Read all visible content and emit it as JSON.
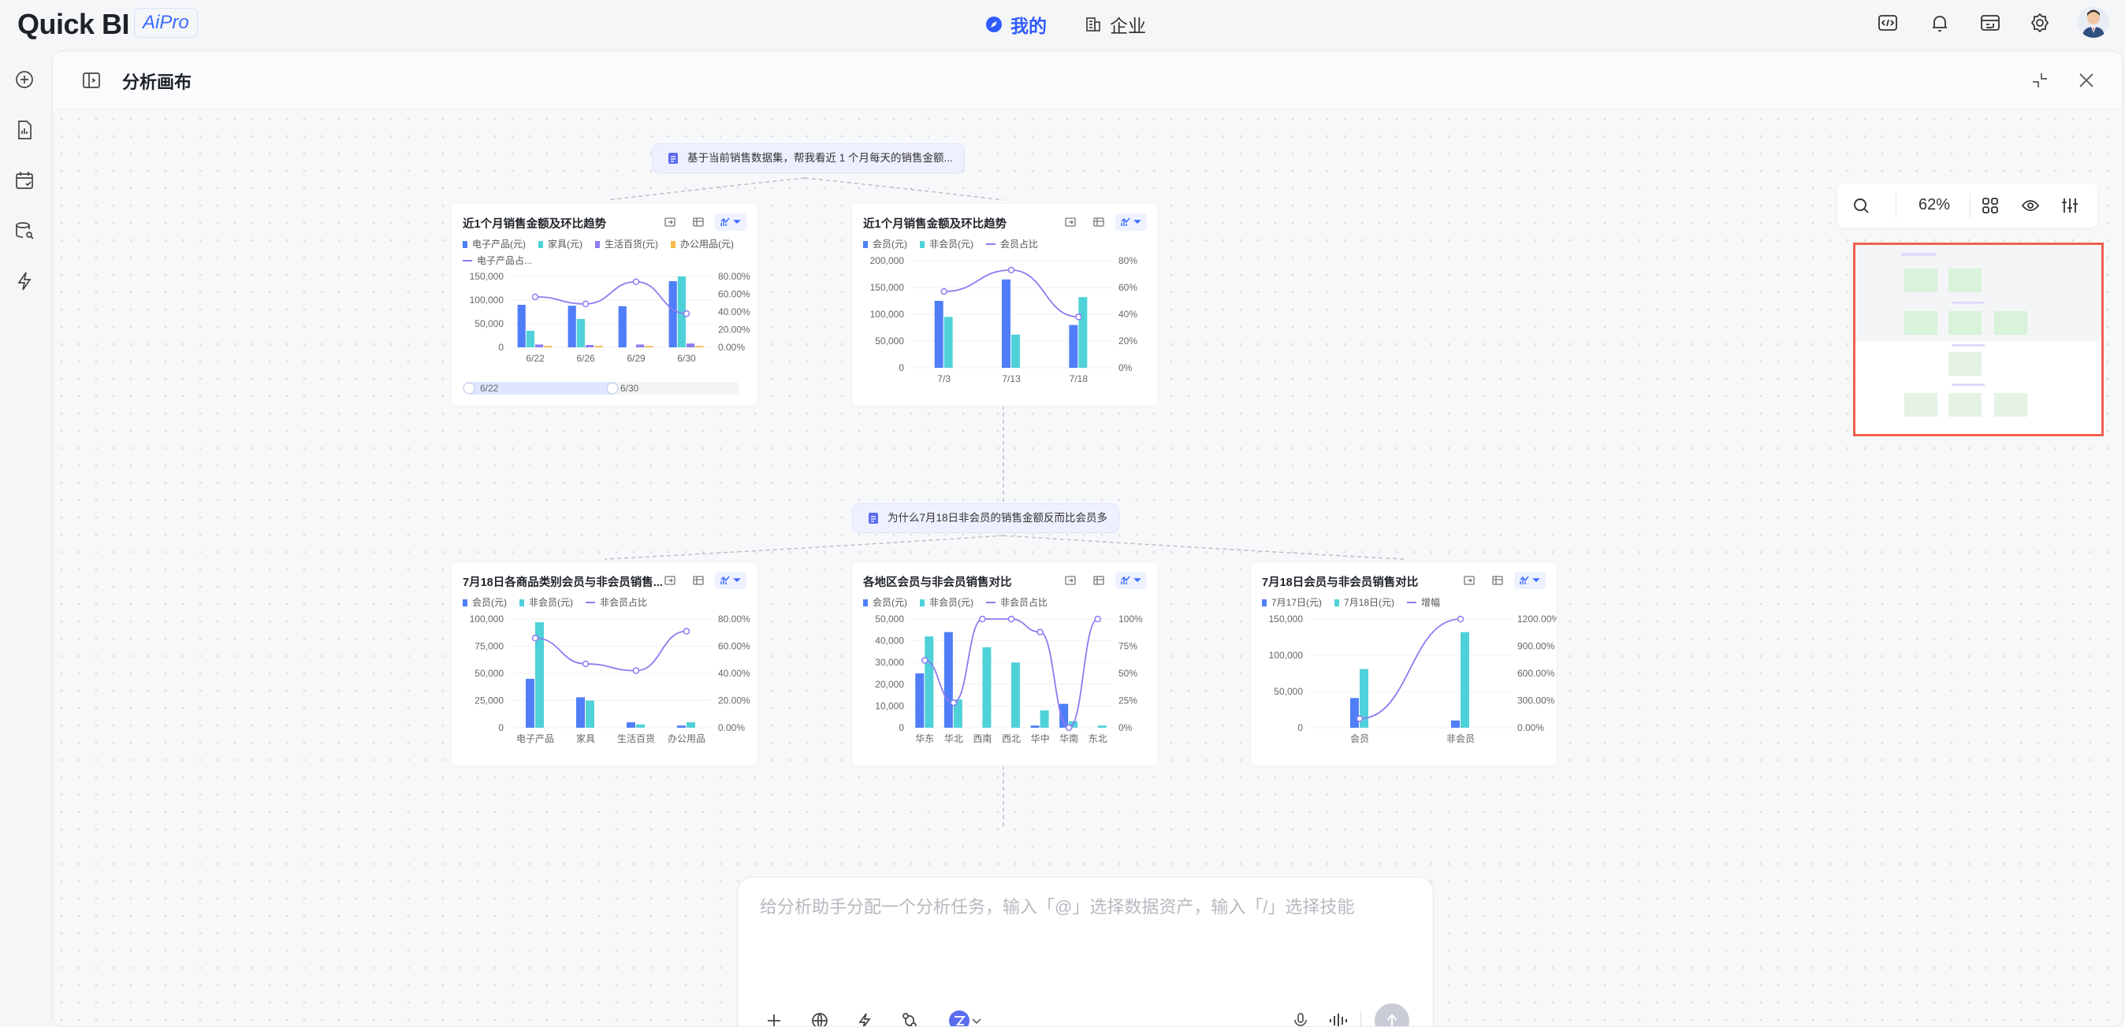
{
  "app": {
    "logo": "Quick BI",
    "badge": "AiPro"
  },
  "nav": {
    "mine": "我的",
    "enterprise": "企业"
  },
  "panel": {
    "title": "分析画布"
  },
  "toolbar": {
    "zoom": "62%"
  },
  "questions": {
    "q1": "基于当前销售数据集，帮我看近 1 个月每天的销售金额...",
    "q2": "为什么7月18日非会员的销售金额反而比会员多"
  },
  "input": {
    "placeholder": "给分析助手分配一个分析任务，输入「@」选择数据资产，输入「/」选择技能"
  },
  "colors": {
    "blue": "#4f7ef8",
    "cyan": "#4fd1d9",
    "purple": "#8b7cf0",
    "orange": "#f7b84b",
    "brand": "#2f5bff",
    "minimap_border": "#f06050"
  },
  "cards": [
    {
      "title": "近1个月销售金额及环比趋势",
      "legend": [
        "电子产品(元)",
        "家具(元)",
        "生活百货(元)",
        "办公用品(元)",
        "电子产品占..."
      ],
      "y_left": [
        "150,000",
        "100,000",
        "50,000",
        "0"
      ],
      "y_right": [
        "80.00%",
        "60.00%",
        "40.00%",
        "20.00%",
        "0.00%"
      ],
      "x": [
        "6/22",
        "6/26",
        "6/29",
        "6/30"
      ],
      "slider": {
        "start": "6/22",
        "end": "6/30"
      }
    },
    {
      "title": "近1个月销售金额及环比趋势",
      "legend": [
        "会员(元)",
        "非会员(元)",
        "会员占比"
      ],
      "y_left": [
        "200,000",
        "150,000",
        "100,000",
        "50,000",
        "0"
      ],
      "y_right": [
        "80%",
        "60%",
        "40%",
        "20%",
        "0%"
      ],
      "x": [
        "7/3",
        "7/13",
        "7/18"
      ]
    },
    {
      "title": "7月18日各商品类别会员与非会员销售...",
      "legend": [
        "会员(元)",
        "非会员(元)",
        "非会员占比"
      ],
      "y_left": [
        "100,000",
        "75,000",
        "50,000",
        "25,000",
        "0"
      ],
      "y_right": [
        "80.00%",
        "60.00%",
        "40.00%",
        "20.00%",
        "0.00%"
      ],
      "x": [
        "电子产品",
        "家具",
        "生活百货",
        "办公用品"
      ]
    },
    {
      "title": "各地区会员与非会员销售对比",
      "legend": [
        "会员(元)",
        "非会员(元)",
        "非会员占比"
      ],
      "y_left": [
        "50,000",
        "40,000",
        "30,000",
        "20,000",
        "10,000",
        "0"
      ],
      "y_right": [
        "100%",
        "75%",
        "50%",
        "25%",
        "0%"
      ],
      "x": [
        "华东",
        "华北",
        "西南",
        "西北",
        "华中",
        "华南",
        "东北"
      ]
    },
    {
      "title": "7月18日会员与非会员销售对比",
      "legend": [
        "7月17日(元)",
        "7月18日(元)",
        "增幅"
      ],
      "y_left": [
        "150,000",
        "100,000",
        "50,000",
        "0"
      ],
      "y_right": [
        "1200.00%",
        "900.00%",
        "600.00%",
        "300.00%",
        "0.00%"
      ],
      "x": [
        "会员",
        "非会员"
      ]
    }
  ],
  "chart_data": [
    {
      "type": "bar",
      "title": "近1个月销售金额及环比趋势",
      "categories": [
        "6/22",
        "6/26",
        "6/29",
        "6/30"
      ],
      "series": [
        {
          "name": "电子产品(元)",
          "values": [
            90000,
            88000,
            87000,
            140000
          ]
        },
        {
          "name": "家具(元)",
          "values": [
            35000,
            60000,
            0,
            150000
          ]
        },
        {
          "name": "生活百货(元)",
          "values": [
            6000,
            5000,
            6000,
            8000
          ]
        },
        {
          "name": "办公用品(元)",
          "values": [
            3000,
            3000,
            3000,
            3000
          ]
        },
        {
          "name": "电子产品占...",
          "axis": "right",
          "values": [
            0.57,
            0.49,
            0.74,
            0.38
          ]
        }
      ],
      "ylim": [
        0,
        150000
      ],
      "y2lim": [
        0,
        0.8
      ]
    },
    {
      "type": "bar",
      "title": "近1个月销售金额及环比趋势",
      "categories": [
        "7/3",
        "7/13",
        "7/18"
      ],
      "series": [
        {
          "name": "会员(元)",
          "values": [
            125000,
            165000,
            80000
          ]
        },
        {
          "name": "非会员(元)",
          "values": [
            95000,
            62000,
            132000
          ]
        },
        {
          "name": "会员占比",
          "axis": "right",
          "values": [
            0.57,
            0.73,
            0.38
          ]
        }
      ],
      "ylim": [
        0,
        200000
      ],
      "y2lim": [
        0,
        0.8
      ]
    },
    {
      "type": "bar",
      "title": "7月18日各商品类别会员与非会员销售...",
      "categories": [
        "电子产品",
        "家具",
        "生活百货",
        "办公用品"
      ],
      "series": [
        {
          "name": "会员(元)",
          "values": [
            45000,
            28000,
            5000,
            2000
          ]
        },
        {
          "name": "非会员(元)",
          "values": [
            97000,
            25000,
            3000,
            5000
          ]
        },
        {
          "name": "非会员占比",
          "axis": "right",
          "values": [
            0.66,
            0.47,
            0.42,
            0.71
          ]
        }
      ],
      "ylim": [
        0,
        100000
      ],
      "y2lim": [
        0,
        0.8
      ]
    },
    {
      "type": "bar",
      "title": "各地区会员与非会员销售对比",
      "categories": [
        "华东",
        "华北",
        "西南",
        "西北",
        "华中",
        "华南",
        "东北"
      ],
      "series": [
        {
          "name": "会员(元)",
          "values": [
            25000,
            44000,
            0,
            0,
            1000,
            11000,
            0
          ]
        },
        {
          "name": "非会员(元)",
          "values": [
            42000,
            13000,
            37000,
            30000,
            8000,
            3000,
            1000
          ]
        },
        {
          "name": "非会员占比",
          "axis": "right",
          "values": [
            0.62,
            0.23,
            1.0,
            1.0,
            0.88,
            0.0,
            1.0
          ]
        }
      ],
      "ylim": [
        0,
        50000
      ],
      "y2lim": [
        0,
        1.0
      ]
    },
    {
      "type": "bar",
      "title": "7月18日会员与非会员销售对比",
      "categories": [
        "会员",
        "非会员"
      ],
      "series": [
        {
          "name": "7月17日(元)",
          "values": [
            41000,
            10000
          ]
        },
        {
          "name": "7月18日(元)",
          "values": [
            81000,
            132000
          ]
        },
        {
          "name": "增幅",
          "axis": "right",
          "values": [
            1.0,
            12.0
          ]
        }
      ],
      "ylim": [
        0,
        150000
      ],
      "y2lim": [
        0,
        12.0
      ]
    }
  ]
}
